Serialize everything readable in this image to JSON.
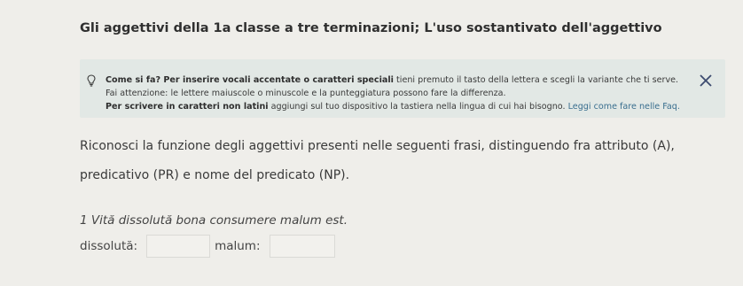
{
  "exercise": {
    "title": "Gli aggettivi della 1a classe a tre terminazioni; L'uso sostantivato dell'aggettivo"
  },
  "info": {
    "bold1": "Come si fa? Per inserire vocali accentate o caratteri speciali",
    "text1": " tieni premuto il tasto della lettera e scegli la variante che ti serve. Fai attenzione: le lettere maiuscole o minuscole e la punteggiatura possono fare la differenza.",
    "bold2": "Per scrivere in caratteri non latini",
    "text2": " aggiungi sul tuo dispositivo la tastiera nella lingua di cui hai bisogno.",
    "link": "Leggi come fare nelle Faq."
  },
  "question": {
    "text": "Riconosci la funzione degli aggettivi presenti nelle seguenti frasi, distinguendo fra attributo (A), predicativo (PR) e nome del predicato (NP)."
  },
  "item1": {
    "sentence": "1 Vită dissolută bona consumere malum est.",
    "label1": "dissolută:",
    "value1": "",
    "label2": "malum:",
    "value2": ""
  },
  "colors": {
    "background": "#efeeea",
    "info_box": "#e2e8e5",
    "link": "#3a6f8f"
  },
  "icons": {
    "info": "lightbulb-icon",
    "close": "close-icon"
  }
}
